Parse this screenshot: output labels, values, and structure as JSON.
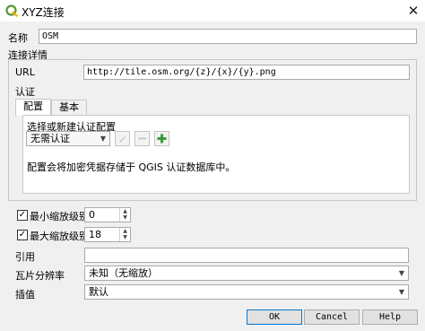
{
  "window": {
    "title": "XYZ连接",
    "close_label": "✕"
  },
  "name_label": "名称",
  "name_value": "OSM",
  "details_group_title": "连接详情",
  "url_label": "URL",
  "url_value": "http://tile.osm.org/{z}/{x}/{y}.png",
  "auth_label": "认证",
  "tabs": [
    {
      "label": "配置"
    },
    {
      "label": "基本"
    }
  ],
  "auth_select_label": "选择或新建认证配置",
  "auth_combo_value": "无需认证",
  "auth_info_text": "配置会将加密凭据存储于 QGIS 认证数据库中。",
  "min_zoom": {
    "label": "最小缩放级别",
    "value": "0",
    "checked": true
  },
  "max_zoom": {
    "label": "最大缩放级别",
    "value": "18",
    "checked": true
  },
  "referer_label": "引用",
  "referer_value": "",
  "tile_resolution_label": "瓦片分辨率",
  "tile_resolution_value": "未知（无缩放）",
  "interpretation_label": "插值",
  "interpretation_value": "默认",
  "buttons": {
    "ok": "OK",
    "cancel": "Cancel",
    "help": "Help"
  },
  "icons": {
    "app": "qgis-logo-icon",
    "edit": "pencil-icon",
    "remove": "minus-icon",
    "add": "plus-icon"
  },
  "colors": {
    "accent": "#0078d7",
    "qgis_green": "#589632",
    "add_green": "#3c9a3c"
  }
}
